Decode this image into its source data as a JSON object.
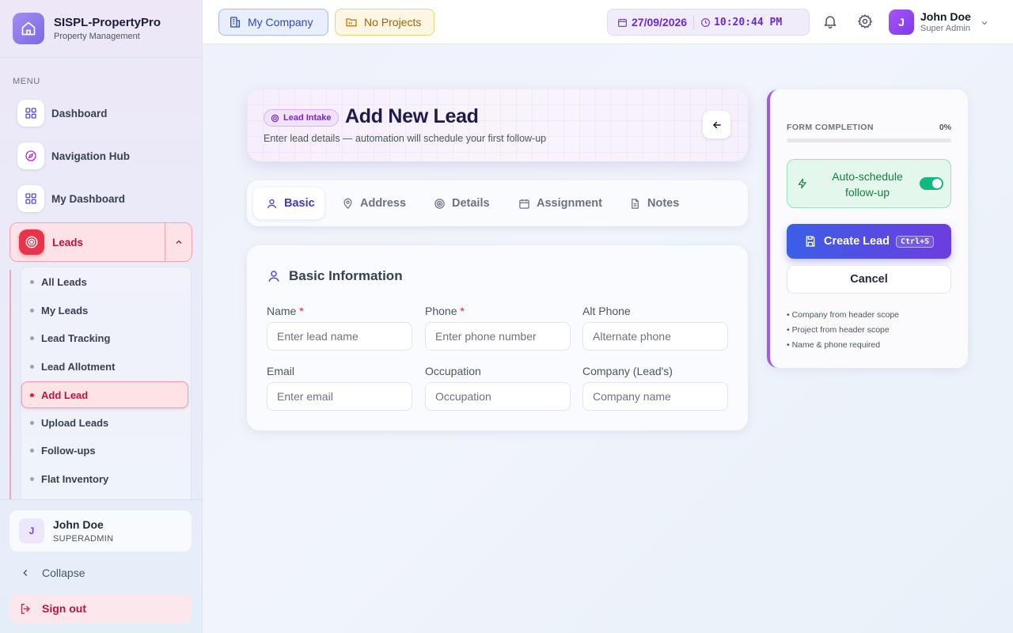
{
  "brand": {
    "title": "SISPL-PropertyPro",
    "subtitle": "Property Management"
  },
  "sidebar": {
    "menu_caption": "MENU",
    "items": [
      {
        "label": "Dashboard",
        "icon": "grid-icon"
      },
      {
        "label": "Navigation Hub",
        "icon": "compass-icon"
      },
      {
        "label": "My Dashboard",
        "icon": "grid-icon"
      }
    ],
    "leads": {
      "label": "Leads",
      "icon": "target-icon",
      "children": [
        "All Leads",
        "My Leads",
        "Lead Tracking",
        "Lead Allotment",
        "Add Lead",
        "Upload Leads",
        "Follow-ups",
        "Flat Inventory"
      ],
      "active": "Add Lead"
    },
    "user": {
      "initial": "J",
      "name": "John Doe",
      "role": "SUPERADMIN"
    },
    "collapse_label": "Collapse",
    "signout_label": "Sign out"
  },
  "header": {
    "company": "My Company",
    "project": "No Projects",
    "date": "27/09/2026",
    "time": "10:20:44 PM",
    "user": {
      "initial": "J",
      "name": "John Doe",
      "role": "Super Admin"
    }
  },
  "page": {
    "badge": "Lead Intake",
    "title": "Add New Lead",
    "subtitle": "Enter lead details — automation will schedule your first follow-up"
  },
  "tabs": [
    {
      "label": "Basic",
      "icon": "user-icon",
      "active": true
    },
    {
      "label": "Address",
      "icon": "map-pin-icon",
      "active": false
    },
    {
      "label": "Details",
      "icon": "target-icon",
      "active": false
    },
    {
      "label": "Assignment",
      "icon": "calendar-icon",
      "active": false
    },
    {
      "label": "Notes",
      "icon": "document-icon",
      "active": false
    }
  ],
  "form": {
    "section_title": "Basic Information",
    "fields": [
      {
        "label": "Name",
        "required": true,
        "value": "",
        "placeholder": "Enter lead name"
      },
      {
        "label": "Phone",
        "required": true,
        "value": "",
        "placeholder": "Enter phone number"
      },
      {
        "label": "Alt Phone",
        "required": false,
        "value": "",
        "placeholder": "Alternate phone"
      },
      {
        "label": "Email",
        "required": false,
        "value": "",
        "placeholder": "Enter email"
      },
      {
        "label": "Occupation",
        "required": false,
        "value": "",
        "placeholder": "Occupation"
      },
      {
        "label": "Company (Lead's)",
        "required": false,
        "value": "",
        "placeholder": "Company name"
      }
    ]
  },
  "panel": {
    "completion_label": "FORM COMPLETION",
    "completion_pct": "0%",
    "completion_fraction": 0,
    "auto_schedule_label": "Auto-schedule follow-up",
    "auto_schedule_on": true,
    "create_label": "Create Lead",
    "create_shortcut": "Ctrl+S",
    "cancel_label": "Cancel",
    "notes": [
      "• Company from header scope",
      "• Project from header scope",
      "• Name & phone required"
    ]
  },
  "colors": {
    "accent": "#4338ca",
    "danger": "#e11d48",
    "success": "#10b981",
    "purple": "#a259e8"
  }
}
